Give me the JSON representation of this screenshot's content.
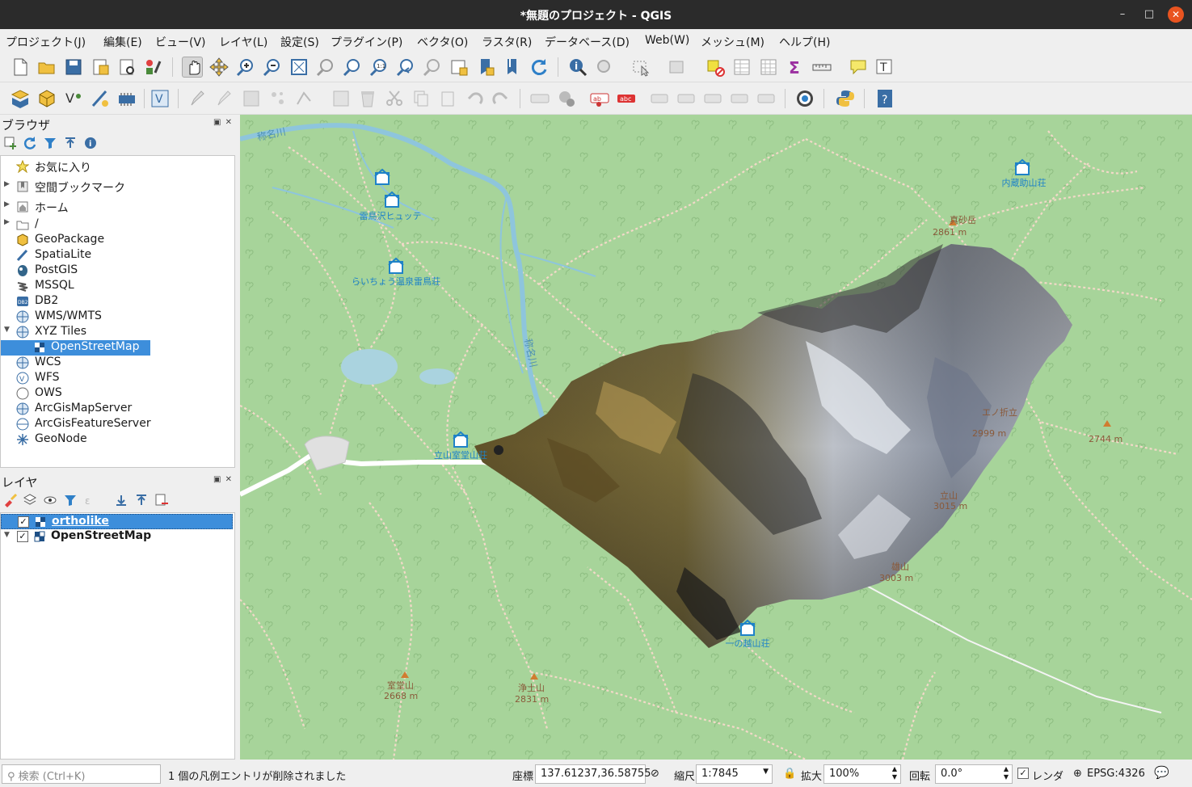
{
  "window": {
    "title": "*無題のプロジェクト - QGIS",
    "minimize": "–",
    "maximize": "□",
    "close": "✕"
  },
  "menu": [
    "プロジェクト(J)",
    "編集(E)",
    "ビュー(V)",
    "レイヤ(L)",
    "設定(S)",
    "プラグイン(P)",
    "ベクタ(O)",
    "ラスタ(R)",
    "データベース(D)",
    "Web(W)",
    "メッシュ(M)",
    "ヘルプ(H)"
  ],
  "browser": {
    "title": "ブラウザ",
    "items": [
      {
        "label": "お気に入り",
        "icon": "star-icon",
        "arrow": ""
      },
      {
        "label": "空間ブックマーク",
        "icon": "bookmark-icon",
        "arrow": "▶"
      },
      {
        "label": "ホーム",
        "icon": "home-icon",
        "arrow": "▶"
      },
      {
        "label": "/",
        "icon": "folder-icon",
        "arrow": "▶"
      },
      {
        "label": "GeoPackage",
        "icon": "geopackage-icon",
        "arrow": ""
      },
      {
        "label": "SpatiaLite",
        "icon": "spatialite-icon",
        "arrow": ""
      },
      {
        "label": "PostGIS",
        "icon": "postgis-icon",
        "arrow": ""
      },
      {
        "label": "MSSQL",
        "icon": "mssql-icon",
        "arrow": ""
      },
      {
        "label": "DB2",
        "icon": "db2-icon",
        "arrow": ""
      },
      {
        "label": "WMS/WMTS",
        "icon": "wms-icon",
        "arrow": ""
      },
      {
        "label": "XYZ Tiles",
        "icon": "xyz-tiles-icon",
        "arrow": "▼"
      },
      {
        "label": "OpenStreetMap",
        "icon": "tile-icon",
        "arrow": ""
      },
      {
        "label": "WCS",
        "icon": "wcs-icon",
        "arrow": ""
      },
      {
        "label": "WFS",
        "icon": "wfs-icon",
        "arrow": ""
      },
      {
        "label": "OWS",
        "icon": "ows-icon",
        "arrow": ""
      },
      {
        "label": "ArcGisMapServer",
        "icon": "arcgis-map-icon",
        "arrow": ""
      },
      {
        "label": "ArcGisFeatureServer",
        "icon": "arcgis-feature-icon",
        "arrow": ""
      },
      {
        "label": "GeoNode",
        "icon": "geonode-icon",
        "arrow": ""
      }
    ]
  },
  "layers": {
    "title": "レイヤ",
    "items": [
      {
        "label": "ortholike",
        "checked": "✓",
        "selected": true
      },
      {
        "label": "OpenStreetMap",
        "checked": "✓",
        "selected": false
      }
    ]
  },
  "map_labels": {
    "river1": "称名川",
    "river2": "称名川",
    "hut1": "雷鳥沢ヒュッテ",
    "hut2": "らいちょう温泉雷鳥荘",
    "hut3": "立山室堂山荘",
    "hut4": "内蔵助山荘",
    "hut5": "一の越山荘",
    "peak1": "真砂岳",
    "peak1_elev": "2861 m",
    "peak2_elev": "2744 m",
    "peak3": "エノ折立",
    "peak3_elev": "2999 m",
    "peak4": "立山",
    "peak4_elev": "3015 m",
    "peak5": "雄山",
    "peak5_elev": "3003 m",
    "peak6": "室堂山",
    "peak6_elev": "2668 m",
    "peak7": "浄土山",
    "peak7_elev": "2831 m"
  },
  "status": {
    "search_placeholder": "検索 (Ctrl+K)",
    "message": "1 個の凡例エントリが削除されました",
    "coord_label": "座標",
    "coord_value": "137.61237,36.58755",
    "scale_label": "縮尺",
    "scale_value": "1:7845",
    "magnifier_label": "拡大",
    "magnifier_value": "100%",
    "rotation_label": "回転",
    "rotation_value": "0.0°",
    "render_label": "レンダ",
    "render_checked": "✓",
    "crs": "EPSG:4326"
  },
  "colors": {
    "map_background": "#a7d49a",
    "river": "#8ec5dc",
    "path": "#f2d9c8",
    "label_blue": "#1e82c8",
    "label_brown": "#8a5a3a",
    "selection": "#3d8edb",
    "title_bar": "#2b2b2b",
    "close_button": "#e95420"
  }
}
